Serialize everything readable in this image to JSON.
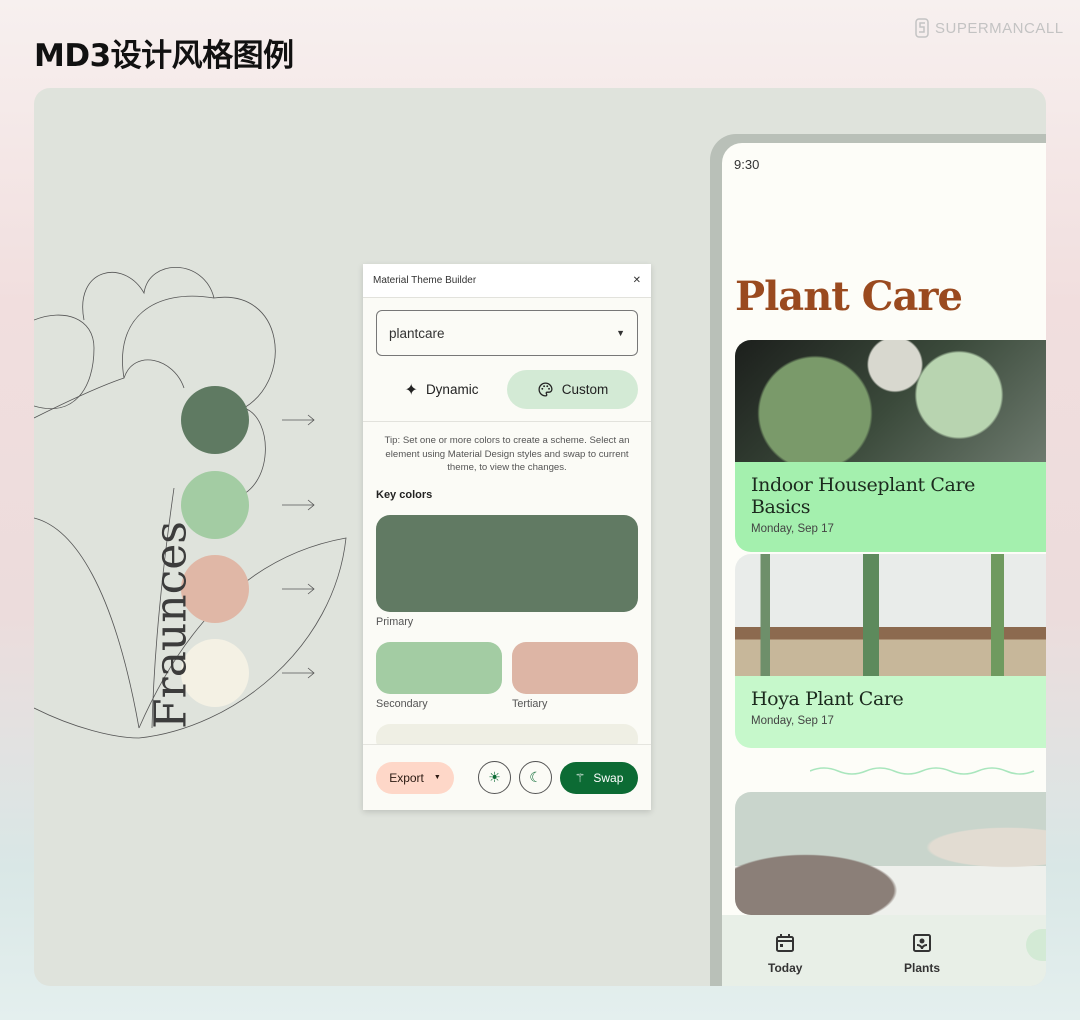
{
  "page": {
    "title": "MD3设计风格图例",
    "brand": "SUPERMANCALL"
  },
  "illustration": {
    "font_label": "Fraunces",
    "palette": [
      "#5f7a62",
      "#a3cca3",
      "#e0b7a6",
      "#f4f1e4"
    ]
  },
  "theme_builder": {
    "title": "Material Theme Builder",
    "close_icon": "close-icon",
    "theme_select": {
      "value": "plantcare"
    },
    "modes": [
      {
        "label": "Dynamic",
        "icon": "sparkle-icon",
        "selected": false
      },
      {
        "label": "Custom",
        "icon": "palette-icon",
        "selected": true
      }
    ],
    "tip": "Tip: Set one or more colors to create a scheme. Select an element using Material Design styles and swap to current theme, to view the changes.",
    "key_colors_heading": "Key colors",
    "key_colors": [
      {
        "label": "Primary",
        "color": "#617a63"
      },
      {
        "label": "Secondary",
        "color": "#a3cca3"
      },
      {
        "label": "Tertiary",
        "color": "#ddb5a5"
      }
    ],
    "footer": {
      "export_label": "Export",
      "swap_label": "Swap",
      "light_icon": "sun-icon",
      "dark_icon": "moon-icon"
    }
  },
  "phone": {
    "status_time": "9:30",
    "app_title": "Plant Care",
    "cards": [
      {
        "title": "Indoor Houseplant Care Basics",
        "date": "Monday, Sep 17",
        "band_color": "#a4f0ae"
      },
      {
        "title": "Hoya Plant Care",
        "date": "Monday, Sep 17",
        "band_color": "#c6f8cb"
      }
    ],
    "nav": [
      {
        "label": "Today",
        "icon": "calendar-icon"
      },
      {
        "label": "Plants",
        "icon": "plant-frame-icon"
      }
    ]
  },
  "colors": {
    "title_brown": "#9a4a1f",
    "swap_green": "#0c6b34",
    "export_peach": "#fed7c8",
    "custom_selected": "#d3ead5"
  }
}
